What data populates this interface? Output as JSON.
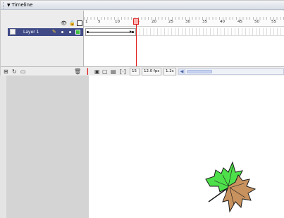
{
  "timeline": {
    "title": "Timeline",
    "layer": {
      "name": "Layer 1"
    },
    "frame_numbers": [
      "1",
      "5",
      "10",
      "15",
      "20",
      "25",
      "30",
      "35",
      "40",
      "45",
      "50",
      "55"
    ],
    "current_frame": "15",
    "fps": "12.0 fps",
    "elapsed": "1.2s"
  },
  "icons": {
    "panel_arrow": "collapse-triangle-icon",
    "header": [
      "eye-icon",
      "lock-icon",
      "outline-square-icon"
    ],
    "layer_page": "layer-page-icon",
    "layer_pencil": "pencil-icon",
    "bottom_left": [
      "insert-layer-icon",
      "motion-guide-icon",
      "insert-folder-icon"
    ],
    "trash": "trash-icon",
    "bottom_tools": [
      "center-frame-icon",
      "onion-skin-icon",
      "onion-skin-outlines-icon",
      "edit-multiple-frames-icon",
      "modify-markers-icon"
    ]
  },
  "colors": {
    "layer_selected": "#3f4a86",
    "playhead": "#e01b1b",
    "leaf_green": "#4ee04a",
    "leaf_brown": "#c8925f",
    "work_area": "#d4d4d4"
  }
}
